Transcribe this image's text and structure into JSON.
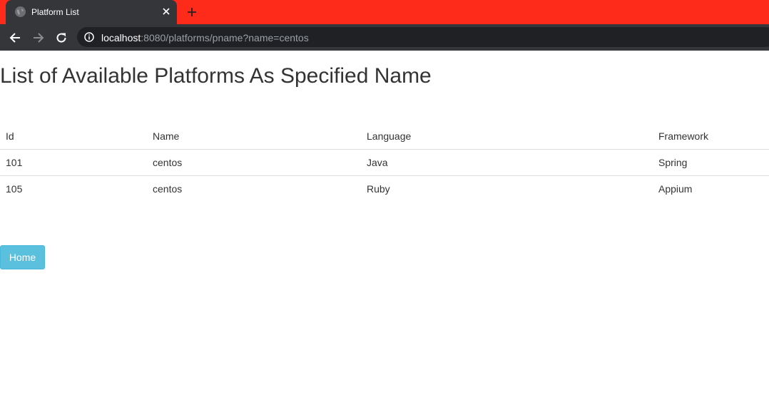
{
  "browser": {
    "tab_title": "Platform List",
    "url_host": "localhost",
    "url_rest": ":8080/platforms/pname?name=centos"
  },
  "page": {
    "title": "List of Available Platforms As Specified Name",
    "table": {
      "headers": [
        "Id",
        "Name",
        "Language",
        "Framework"
      ],
      "rows": [
        [
          "101",
          "centos",
          "Java",
          "Spring"
        ],
        [
          "105",
          "centos",
          "Ruby",
          "Appium"
        ]
      ]
    },
    "home_button_label": "Home"
  }
}
